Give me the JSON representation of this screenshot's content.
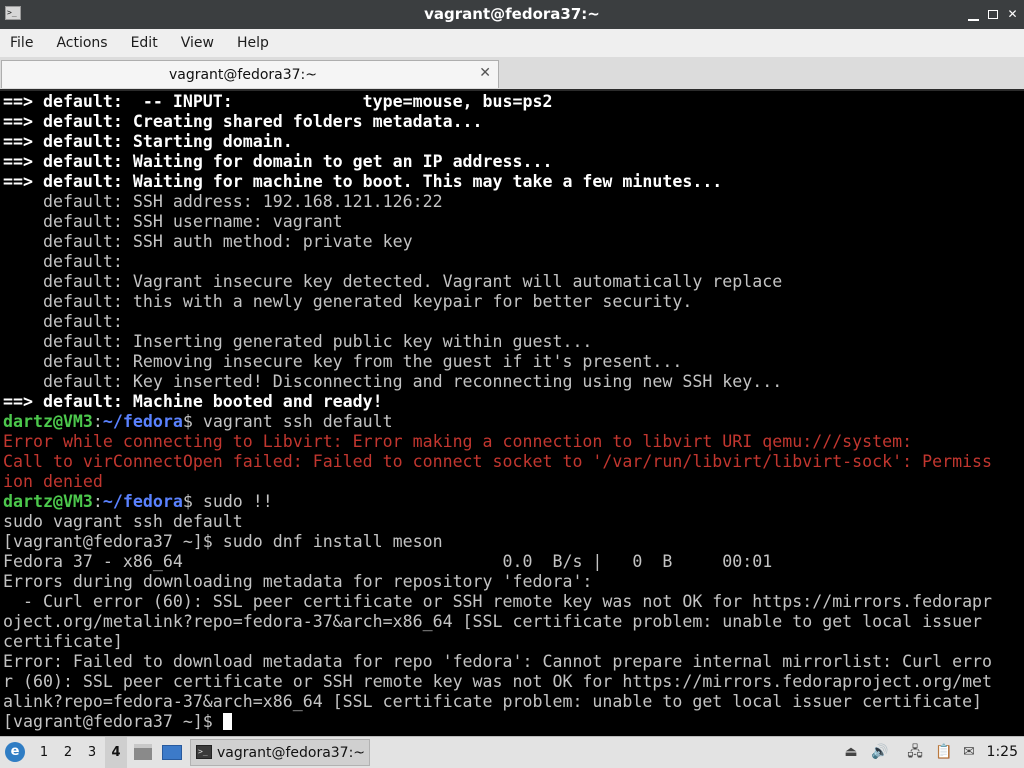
{
  "window": {
    "title": "vagrant@fedora37:~",
    "icon": "terminal-icon",
    "buttons": [
      "minimize-icon",
      "restore-icon",
      "close-icon"
    ]
  },
  "menu": {
    "file": "File",
    "actions": "Actions",
    "edit": "Edit",
    "view": "View",
    "help": "Help"
  },
  "tab": {
    "label": "vagrant@fedora37:~",
    "close": "✕"
  },
  "terminal": {
    "lines": [
      "==> default:  -- INPUT:             type=mouse, bus=ps2",
      "==> default: Creating shared folders metadata...",
      "==> default: Starting domain.",
      "==> default: Waiting for domain to get an IP address...",
      "==> default: Waiting for machine to boot. This may take a few minutes...",
      "    default: SSH address: 192.168.121.126:22",
      "    default: SSH username: vagrant",
      "    default: SSH auth method: private key",
      "    default: ",
      "    default: Vagrant insecure key detected. Vagrant will automatically replace",
      "    default: this with a newly generated keypair for better security.",
      "    default: ",
      "    default: Inserting generated public key within guest...",
      "    default: Removing insecure key from the guest if it's present...",
      "    default: Key inserted! Disconnecting and reconnecting using new SSH key...",
      "==> default: Machine booted and ready!",
      "dartz@VM3:~/fedora$ vagrant ssh default",
      "Error while connecting to Libvirt: Error making a connection to libvirt URI qemu:///system:",
      "Call to virConnectOpen failed: Failed to connect socket to '/var/run/libvirt/libvirt-sock': Permiss",
      "ion denied",
      "dartz@VM3:~/fedora$ sudo !!",
      "sudo vagrant ssh default",
      "[vagrant@fedora37 ~]$ sudo dnf install meson",
      "Fedora 37 - x86_64                                0.0  B/s |   0  B     00:01",
      "Errors during downloading metadata for repository 'fedora':",
      "  - Curl error (60): SSL peer certificate or SSH remote key was not OK for https://mirrors.fedorapr",
      "oject.org/metalink?repo=fedora-37&arch=x86_64 [SSL certificate problem: unable to get local issuer",
      "certificate]",
      "Error: Failed to download metadata for repo 'fedora': Cannot prepare internal mirrorlist: Curl erro",
      "r (60): SSL peer certificate or SSH remote key was not OK for https://mirrors.fedoraproject.org/met",
      "alink?repo=fedora-37&arch=x86_64 [SSL certificate problem: unable to get local issuer certificate]",
      "[vagrant@fedora37 ~]$ "
    ],
    "colors": {
      "background": "#000000",
      "text": "#c3c3c3",
      "bold": "#ffffff",
      "error": "#c2362f",
      "prompt_user": "#4cc84c",
      "prompt_path": "#5a82ff"
    }
  },
  "taskbar": {
    "start_icon": "start-menu-icon",
    "workspaces": [
      "1",
      "2",
      "3",
      "4"
    ],
    "active_workspace": "4",
    "launchers": [
      "file-manager-icon",
      "show-desktop-icon"
    ],
    "task": {
      "label": "vagrant@fedora37:~",
      "icon": "terminal-icon"
    },
    "tray": [
      "eject-icon",
      "volume-icon",
      "network-icon",
      "clipboard-icon",
      "update-icon"
    ],
    "clock": "1:25"
  }
}
